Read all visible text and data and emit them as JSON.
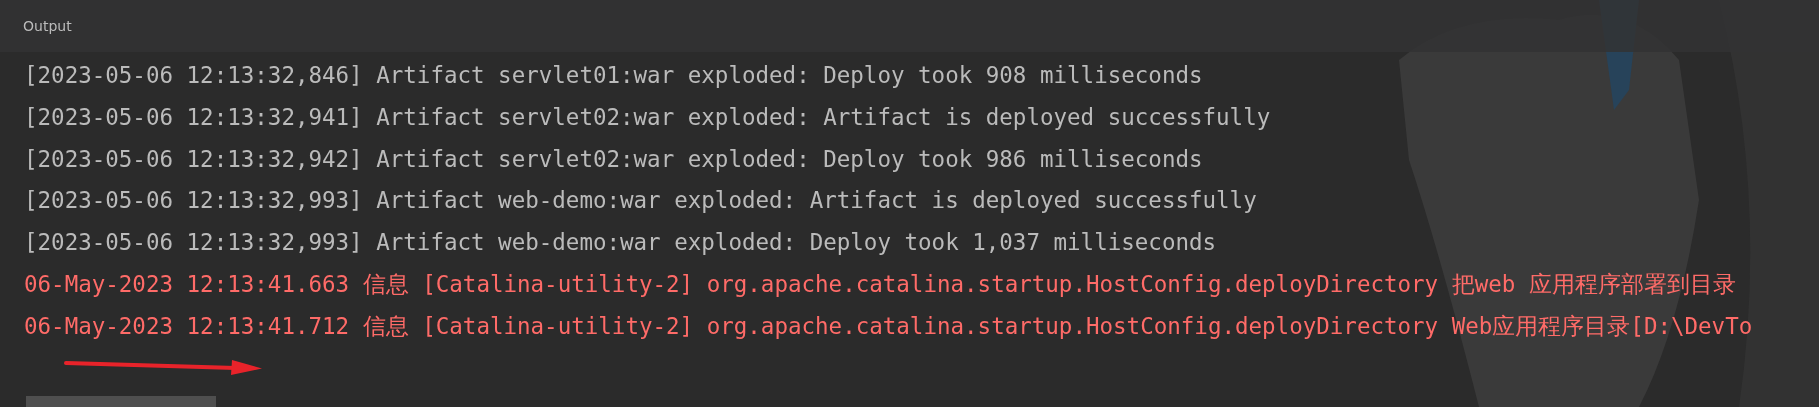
{
  "panel": {
    "title": "Output"
  },
  "lines": [
    {
      "kind": "stdout",
      "text": "[2023-05-06 12:13:32,846] Artifact servlet01:war exploded: Deploy took 908 milliseconds"
    },
    {
      "kind": "stdout",
      "text": "[2023-05-06 12:13:32,941] Artifact servlet02:war exploded: Artifact is deployed successfully"
    },
    {
      "kind": "stdout",
      "text": "[2023-05-06 12:13:32,942] Artifact servlet02:war exploded: Deploy took 986 milliseconds"
    },
    {
      "kind": "stdout",
      "text": "[2023-05-06 12:13:32,993] Artifact web-demo:war exploded: Artifact is deployed successfully"
    },
    {
      "kind": "stdout",
      "text": "[2023-05-06 12:13:32,993] Artifact web-demo:war exploded: Deploy took 1,037 milliseconds"
    },
    {
      "kind": "stderr",
      "text": "06-May-2023 12:13:41.663 信息 [Catalina-utility-2] org.apache.catalina.startup.HostConfig.deployDirectory 把web 应用程序部署到目录"
    },
    {
      "kind": "stderr",
      "text": "06-May-2023 12:13:41.712 信息 [Catalina-utility-2] org.apache.catalina.startup.HostConfig.deployDirectory Web应用程序目录[D:\\DevTo"
    }
  ]
}
